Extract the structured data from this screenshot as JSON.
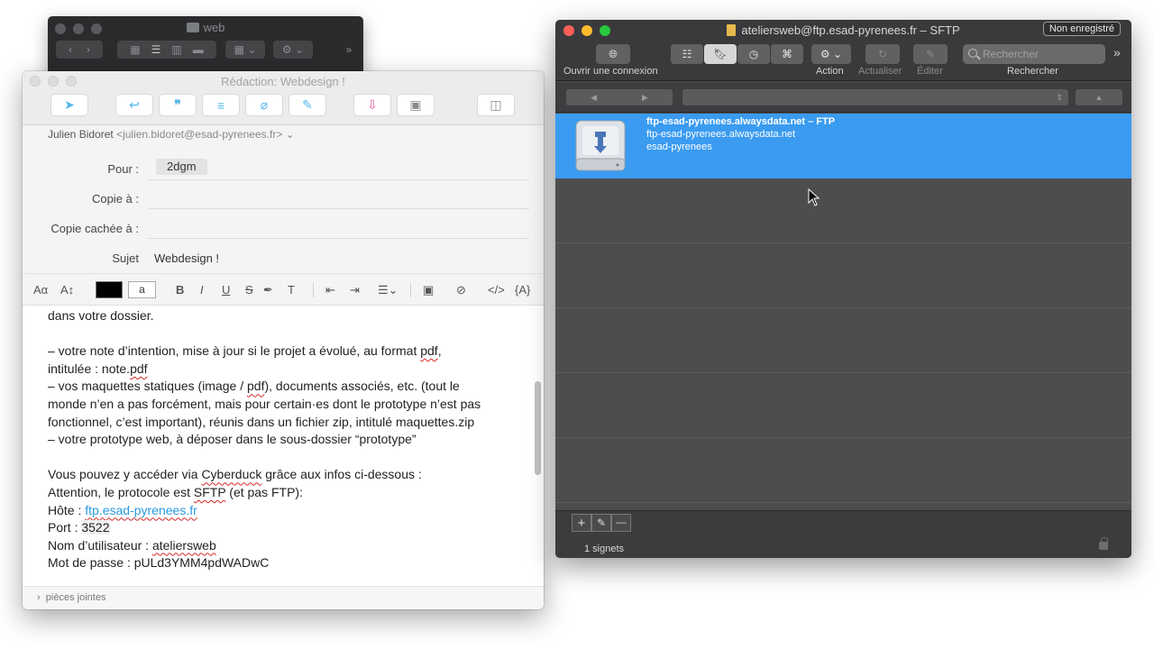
{
  "finder": {
    "title": "web",
    "icons": [
      "folder-icon",
      "chevron-left-icon",
      "chevron-right-icon",
      "icon-view-icon",
      "list-view-icon",
      "column-view-icon",
      "gallery-view-icon",
      "group-icon",
      "gear-icon",
      "overflow-icon"
    ]
  },
  "mail": {
    "title": "Rédaction: Webdesign !",
    "from_name": "Julien Bidoret",
    "from_address": "<julien.bidoret@esad-pyrenees.fr>",
    "to_label": "Pour :",
    "to_value": "2dgm",
    "cc_label": "Copie à :",
    "bcc_label": "Copie cachée à :",
    "subject_label": "Sujet",
    "subject_value": "Webdesign !",
    "format": {
      "font_button": "Aα",
      "size_button": "A↕",
      "bg_swatch_letter": "a",
      "bold": "B",
      "italic": "I",
      "underline": "U",
      "strike": "S",
      "clear": "T"
    },
    "body": {
      "l1": "dans votre dossier.",
      "l3a": "– votre note d’intention, mise à jour si le projet a évolué, au format ",
      "l3b": "pdf",
      "l3c": ",",
      "l4a": "intitulée : note.",
      "l4b": "pdf",
      "l5a": "– vos maquettes statiques (image / ",
      "l5b": "pdf",
      "l5c": "), documents associés, etc. (tout le",
      "l6": "monde n’en a pas forcément, mais pour certain·es dont le prototype n’est pas",
      "l7": "fonctionnel, c’est important), réunis dans un fichier zip, intitulé maquettes.zip",
      "l8": "– votre prototype web, à déposer dans le sous-dossier “prototype”",
      "l10a": "Vous pouvez y accéder via ",
      "l10b": "Cyberduck",
      "l10c": " grâce aux infos ci-dessous :",
      "l11a": "Attention, le protocole est ",
      "l11b": "SFTP",
      "l11c": " (et pas FTP):",
      "l12a": "Hôte : ",
      "l12b": "ftp.esad-pyrenees.fr",
      "l13a": "Port : ",
      "l13b": "3522",
      "l14a": "Nom d’utilisateur : ",
      "l14b": "ateliersweb",
      "l15": "Mot de passe : pULd3YMM4pdWADwC"
    },
    "attachments_label": "pièces jointes"
  },
  "cyberduck": {
    "title": "ateliersweb@ftp.esad-pyrenees.fr – SFTP",
    "badge": "Non enregistré",
    "open_connection_label": "Ouvrir une connexion",
    "action_label": "Action",
    "refresh_label": "Actualiser",
    "edit_label": "Éditer",
    "search_placeholder": "Rechercher",
    "search_label": "Rechercher",
    "bookmark": {
      "title": "ftp-esad-pyrenees.alwaysdata.net – FTP",
      "host": "ftp-esad-pyrenees.alwaysdata.net",
      "user": "esad-pyrenees"
    },
    "add_button": "+",
    "remove_button": "—",
    "status": "1 signets",
    "selection_color": "#3a9bf0"
  }
}
